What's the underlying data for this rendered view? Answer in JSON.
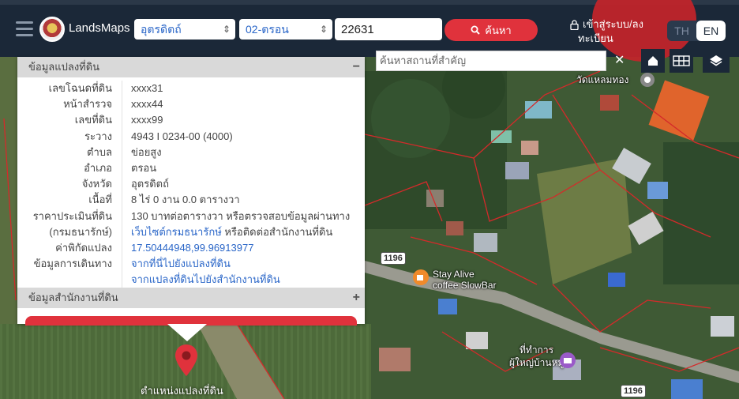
{
  "header": {
    "brand": "LandsMaps",
    "province_select": "อุตรดิตถ์",
    "district_select": "02-ตรอน",
    "parcel_input": "22631",
    "search_button": "ค้นหา",
    "login_line1": "เข้าสู่ระบบ/ลง",
    "login_line2": "ทะเบียน",
    "lang_th": "TH",
    "lang_en": "EN"
  },
  "map": {
    "place_search_placeholder": "ค้นหาสถานที่สำคัญ",
    "clear_symbol": "✕",
    "labels": {
      "temple": "วัดแหลมทอง",
      "cafe_line1": "Stay Alive",
      "cafe_line2": "coffee SlowBar",
      "office_line1": "ที่ทำการ",
      "office_line2": "ผู้ใหญ่บ้านหมู่...",
      "pin_label": "ตำแหน่งแปลงที่ดิน"
    },
    "road_badges": [
      "1196",
      "1196"
    ]
  },
  "info_panel": {
    "title": "ข้อมูลแปลงที่ดิน",
    "collapse_symbol": "−",
    "rows": [
      {
        "label": "เลขโฉนดที่ดิน",
        "value": "xxxx31"
      },
      {
        "label": "หน้าสำรวจ",
        "value": "xxxx44"
      },
      {
        "label": "เลขที่ดิน",
        "value": "xxxx99"
      },
      {
        "label": "ระวาง",
        "value": "4943 I 0234-00 (4000)"
      },
      {
        "label": "ตำบล",
        "value": "ข่อยสูง"
      },
      {
        "label": "อำเภอ",
        "value": "ตรอน"
      },
      {
        "label": "จังหวัด",
        "value": "อุตรดิตถ์"
      },
      {
        "label": "เนื้อที่",
        "value": "8 ไร่ 0 งาน 0.0 ตารางวา"
      },
      {
        "label": "ราคาประเมินที่ดิน",
        "value": "130 บาทต่อตารางวา หรือตรวจสอบข้อมูลผ่านทาง"
      },
      {
        "label": "(กรมธนารักษ์)",
        "value_link": "เว็บไซต์กรมธนารักษ์",
        "value_rest": " หรือติดต่อสำนักงานที่ดิน"
      },
      {
        "label": "ค่าพิกัดแปลง",
        "value": "17.50444948,99.96913977"
      },
      {
        "label": "ข้อมูลการเดินทาง",
        "value": "จากที่นี่ไปยังแปลงที่ดิน"
      },
      {
        "label": "",
        "value": "จากแปลงที่ดินไปยังสำนักงานที่ดิน"
      }
    ],
    "office_title": "ข้อมูลสำนักงานที่ดิน",
    "expand_symbol": "+"
  },
  "colors": {
    "header_bg": "#1b2838",
    "accent_red": "#e0323c",
    "link_blue": "#2a66c8"
  }
}
